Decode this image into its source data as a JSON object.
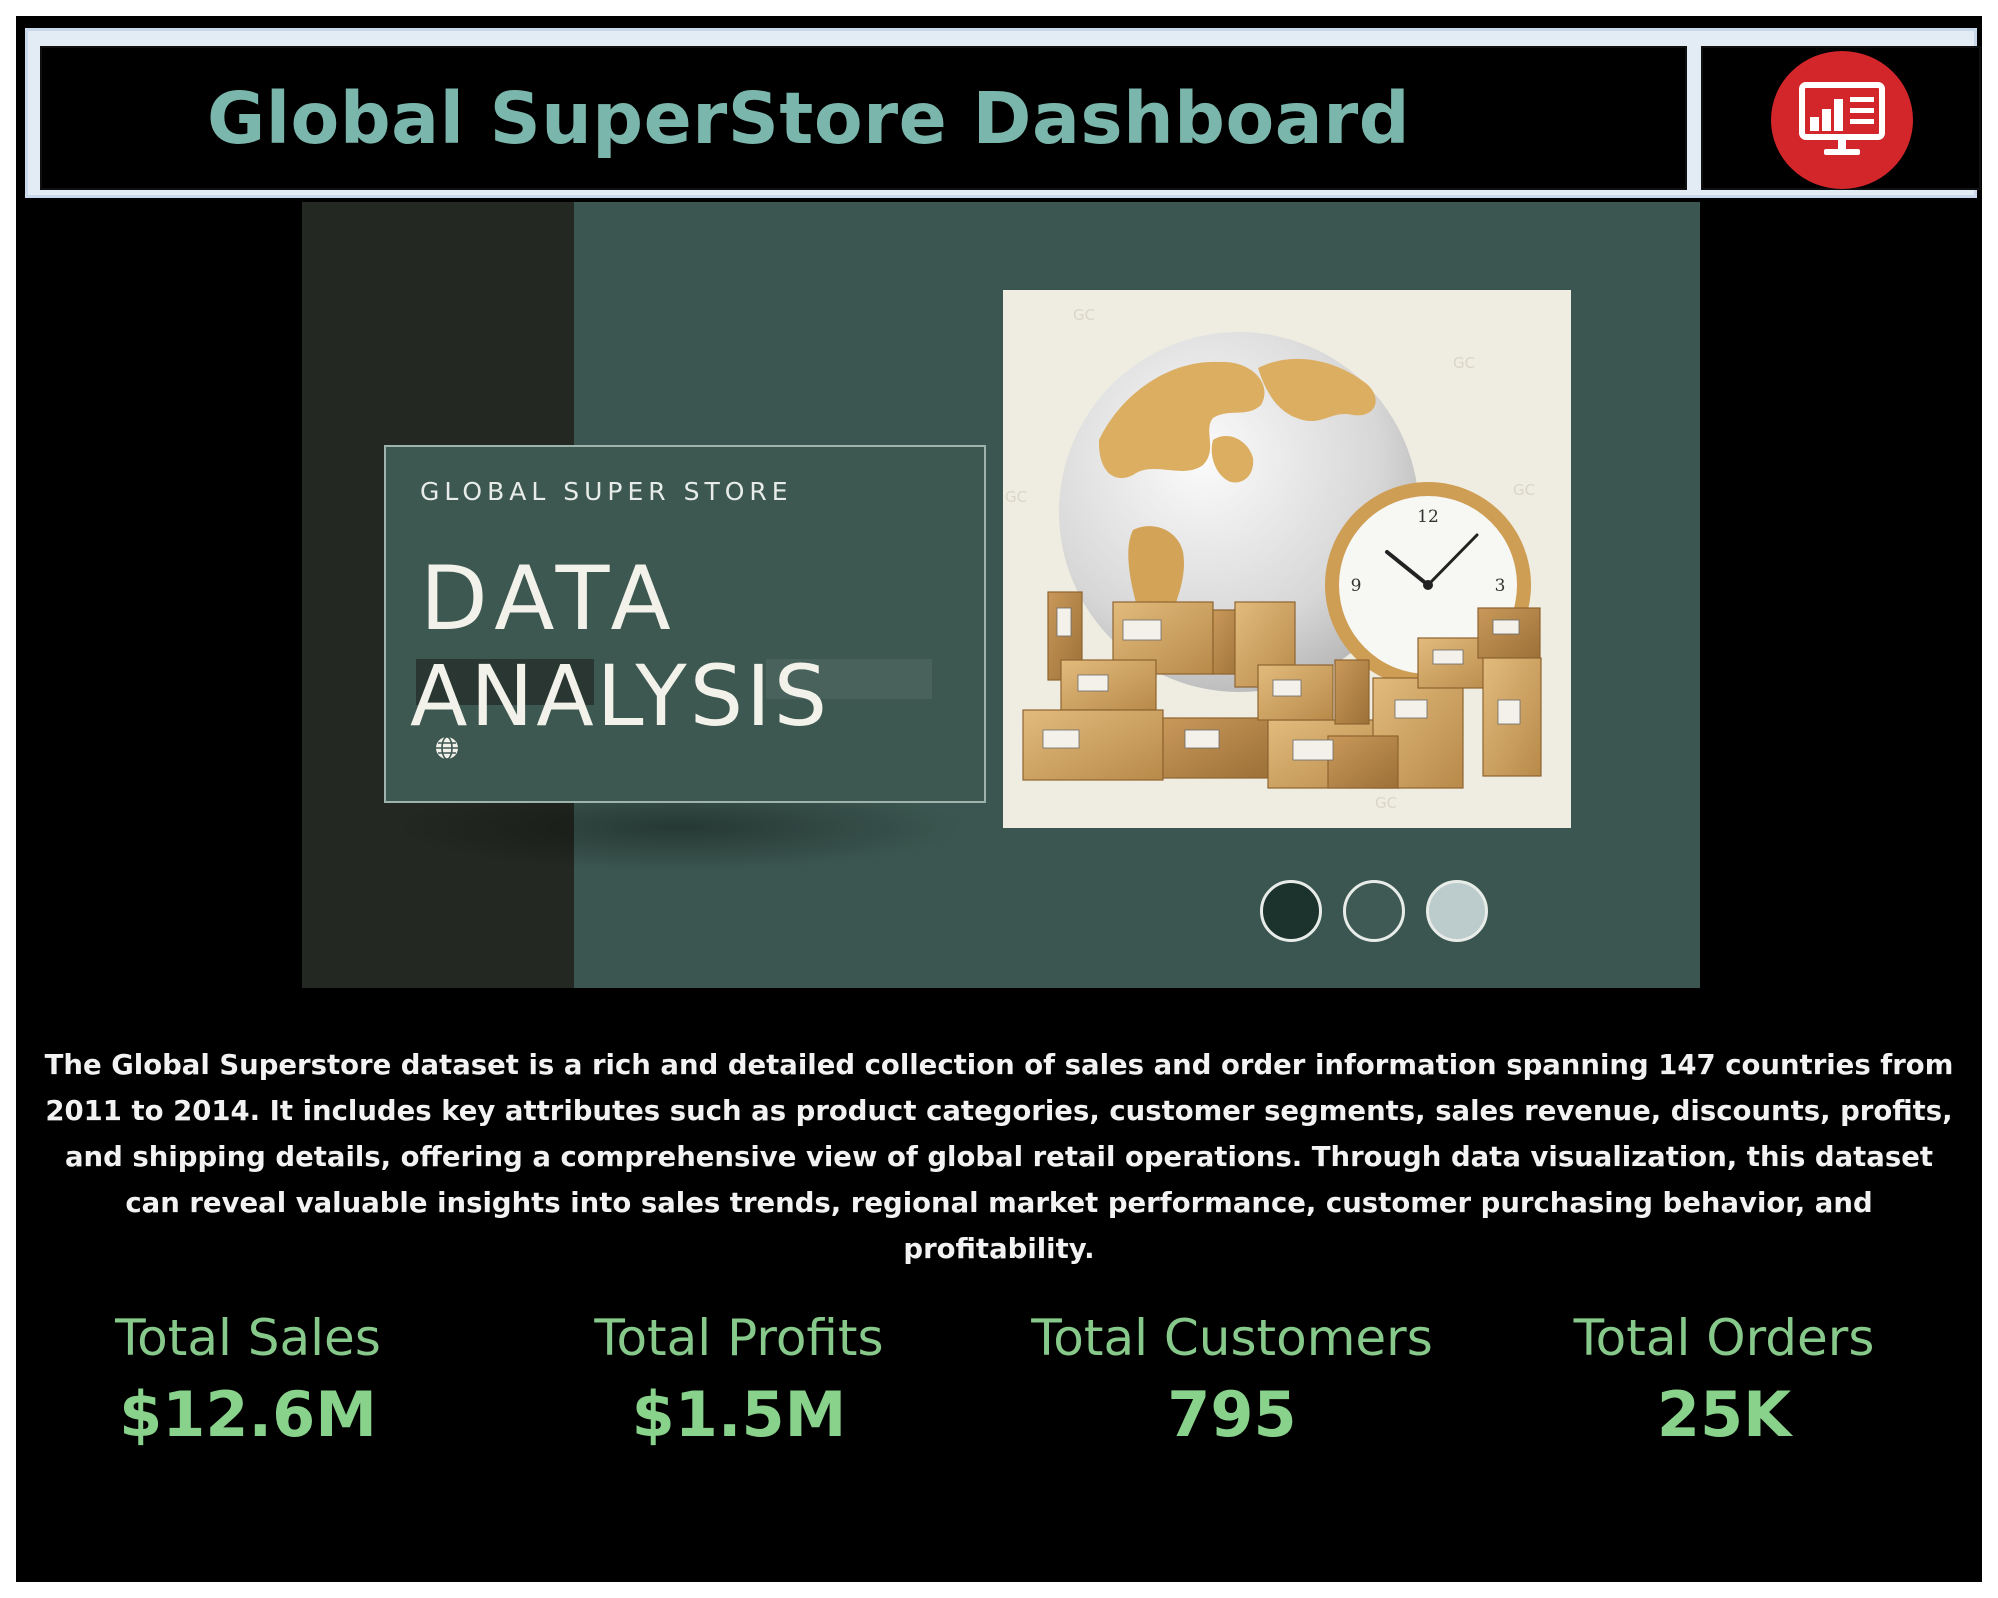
{
  "header": {
    "title": "Global SuperStore Dashboard",
    "logo_icon": "monitor-chart-icon",
    "logo_color": "#d3262b"
  },
  "banner": {
    "kicker": "GLOBAL SUPER STORE",
    "headline_line1": "DATA",
    "headline_line2": "ANALYSIS",
    "image_icon": "globe-boxes-clock-illustration",
    "watermark": "GC",
    "clock_numerals": [
      "12",
      "3",
      "9"
    ],
    "palette_dots": [
      "#1b332c",
      "#3f5a54",
      "#bccbcc"
    ]
  },
  "description": "The Global Superstore dataset is a rich and detailed collection of sales and order information spanning 147 countries from 2011 to 2014. It includes key attributes such as product categories, customer segments, sales revenue, discounts, profits, and shipping details, offering a comprehensive view of global retail operations. Through data visualization, this dataset can reveal valuable insights into sales trends, regional market performance, customer purchasing behavior, and profitability.",
  "kpis": [
    {
      "label": "Total Sales",
      "value": "$12.6M"
    },
    {
      "label": "Total Profits",
      "value": "$1.5M"
    },
    {
      "label": "Total Customers",
      "value": "795"
    },
    {
      "label": "Total Orders",
      "value": "25K"
    }
  ],
  "colors": {
    "title": "#7ab6ac",
    "kpi": "#86c98a",
    "background": "#000000"
  }
}
